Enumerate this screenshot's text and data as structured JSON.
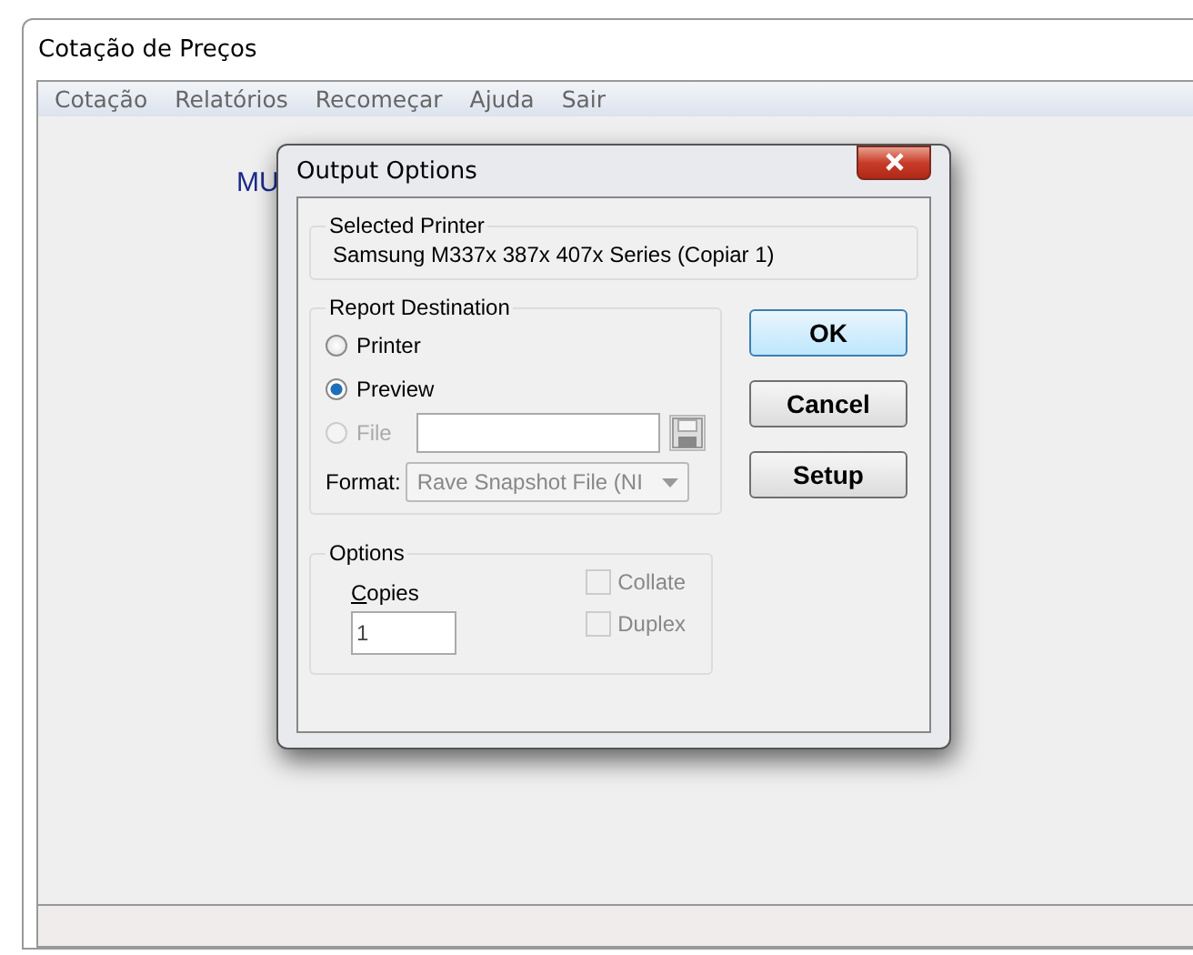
{
  "window": {
    "title": "Cotação de Preços"
  },
  "menu": [
    {
      "label": "Cotação"
    },
    {
      "label": "Relatórios"
    },
    {
      "label": "Recomeçar"
    },
    {
      "label": "Ajuda"
    },
    {
      "label": "Sair"
    }
  ],
  "background_label": "MU",
  "dialog": {
    "title": "Output Options",
    "selected_printer": {
      "legend": "Selected Printer",
      "value": "Samsung M337x 387x 407x Series (Copiar 1)"
    },
    "report_destination": {
      "legend": "Report Destination",
      "options": [
        {
          "label": "Printer",
          "selected": false,
          "disabled": false
        },
        {
          "label": "Preview",
          "selected": true,
          "disabled": false
        },
        {
          "label": "File",
          "selected": false,
          "disabled": true
        }
      ],
      "file_path": {
        "disabled": false
      },
      "format": {
        "label": "Format:",
        "value": "Rave Snapshot File (NI",
        "disabled": true
      }
    },
    "options": {
      "legend": "Options",
      "copies": {
        "label": "Copies",
        "value": "1"
      },
      "checkboxes": [
        {
          "label": "Collate",
          "checked": false,
          "disabled": true
        },
        {
          "label": "Duplex",
          "checked": false,
          "disabled": true
        }
      ]
    },
    "buttons": [
      {
        "label": "OK",
        "default": true
      },
      {
        "label": "Cancel",
        "default": false
      },
      {
        "label": "Setup",
        "default": false
      }
    ]
  }
}
